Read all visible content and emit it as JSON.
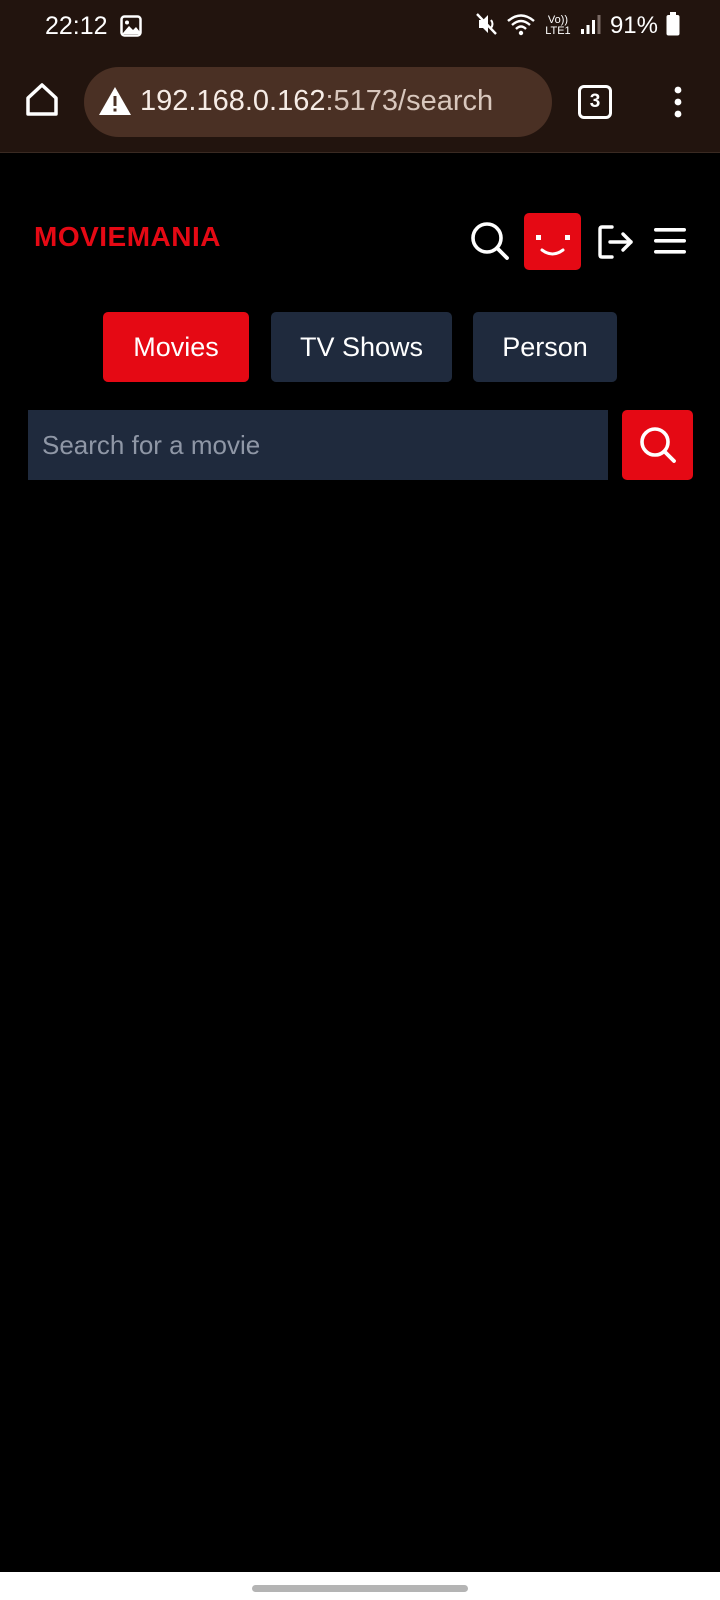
{
  "status_bar": {
    "time": "22:12",
    "network_label": "Vo)) LTE1",
    "battery": "91%",
    "icons": [
      "gallery-icon",
      "mute-icon",
      "wifi-icon",
      "signal-icon",
      "battery-icon"
    ]
  },
  "browser": {
    "url_host": "192.168.0.162",
    "url_path": ":5173/search",
    "tab_count": "3",
    "icons": [
      "home-icon",
      "warning-icon",
      "more-vert-icon"
    ]
  },
  "app": {
    "logo": "MovieMania",
    "header_icons": [
      "search-icon",
      "avatar-face-icon",
      "logout-icon",
      "hamburger-menu-icon"
    ],
    "categories": [
      {
        "label": "Movies",
        "active": true
      },
      {
        "label": "TV Shows",
        "active": false
      },
      {
        "label": "Person",
        "active": false
      }
    ],
    "search": {
      "placeholder": "Search for a movie",
      "value": ""
    }
  },
  "colors": {
    "brand_red": "#e50914",
    "chip_navy": "#1f2a3d",
    "background": "#000000",
    "browser_chrome": "#22140e"
  }
}
